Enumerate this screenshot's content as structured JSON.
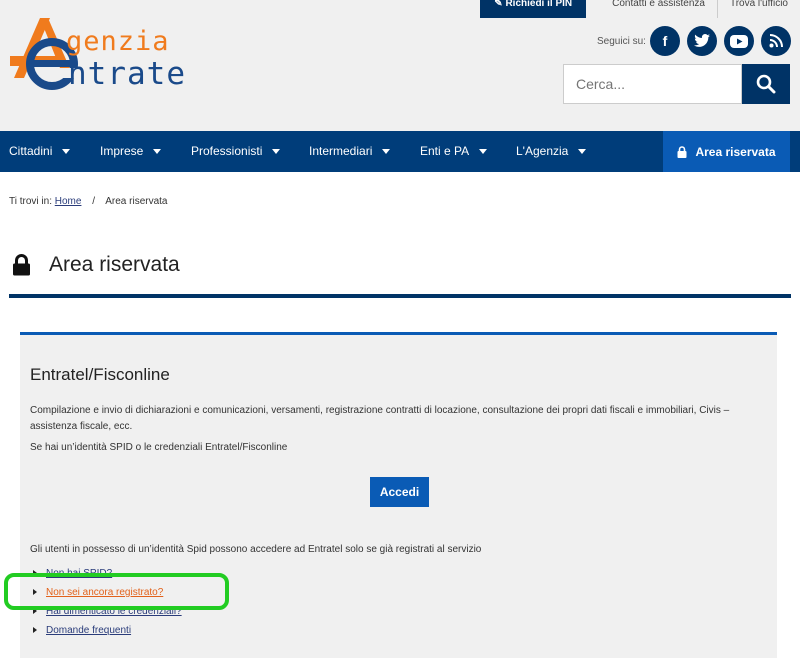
{
  "header": {
    "logo_agenzia": "genzia",
    "logo_entrate": "ntrate",
    "top_links": {
      "pin": "Richiedi il PIN",
      "assistance": "Contatti e assistenza",
      "office": "Trova l'ufficio"
    },
    "social_label": "Seguici su:",
    "social_icons": [
      "facebook-icon",
      "twitter-icon",
      "youtube-icon",
      "rss-icon"
    ],
    "search_placeholder": "Cerca..."
  },
  "nav": {
    "items": [
      "Cittadini",
      "Imprese",
      "Professionisti",
      "Intermediari",
      "Enti e PA",
      "L'Agenzia"
    ],
    "area_riservata": "Area riservata"
  },
  "breadcrumb": {
    "prefix": "Ti trovi in:",
    "home": "Home",
    "separator": "/",
    "current": "Area riservata"
  },
  "page_title": "Area riservata",
  "card": {
    "title": "Entratel/Fisconline",
    "description": "Compilazione e invio di dichiarazioni e comunicazioni, versamenti, registrazione contratti di locazione, consultazione dei propri dati fiscali e immobiliari, Civis – assistenza fiscale, ecc.",
    "spid_text": "Se hai un’identità SPID o le credenziali Entratel/Fisconline",
    "accedi_label": "Accedi",
    "note": "Gli utenti in possesso di un’identità Spid possono accedere ad Entratel solo se già registrati al servizio",
    "links": [
      "Non hai SPID?",
      "Non sei ancora registrato?",
      "Hai dimenticato le credenziali?",
      "Domande frequenti"
    ]
  },
  "colors": {
    "brand_blue": "#003366",
    "nav_blue": "#003d7a",
    "accent_blue": "#0a5bb5",
    "logo_orange": "#f07b1d",
    "highlight_green": "#22cc22"
  }
}
